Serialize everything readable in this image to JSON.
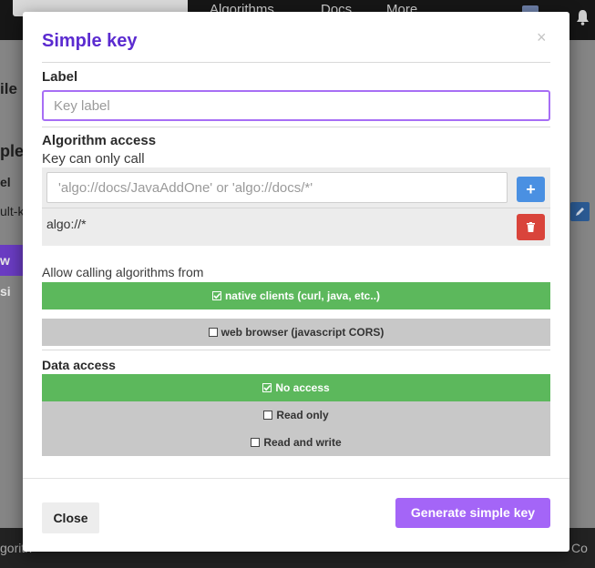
{
  "background": {
    "nav_fragments": [
      "Algorithms",
      "Docs",
      "More"
    ],
    "page_fragments": [
      "ile",
      "ple",
      "el",
      "ult-k"
    ],
    "purple_button_fragment": "w si",
    "footer_fragments": [
      "gorith",
      "Co"
    ]
  },
  "modal": {
    "title": "Simple key",
    "close_x": "×",
    "label": {
      "heading": "Label",
      "placeholder": "Key label",
      "value": ""
    },
    "algorithm_access": {
      "heading": "Algorithm access",
      "subheading": "Key can only call",
      "input_placeholder": "'algo://docs/JavaAddOne' or 'algo://docs/*'",
      "add_label": "+",
      "items": [
        "algo://*"
      ]
    },
    "calling_from": {
      "heading": "Allow calling algorithms from",
      "options": [
        {
          "label": "native clients (curl, java, etc..)",
          "checked": true
        },
        {
          "label": "web browser (javascript CORS)",
          "checked": false
        }
      ]
    },
    "data_access": {
      "heading": "Data access",
      "options": [
        {
          "label": "No access",
          "checked": true
        },
        {
          "label": "Read only",
          "checked": false
        },
        {
          "label": "Read and write",
          "checked": false
        }
      ]
    },
    "close_button": "Close",
    "generate_button": "Generate simple key"
  },
  "colors": {
    "accent": "#a465f7",
    "title": "#5b2bd0",
    "selected_green": "#5cb85c",
    "unselected_gray": "#c8c8c8",
    "add_blue": "#4a90e2",
    "delete_red": "#d9443b"
  },
  "icons": {
    "checked": "check-square-icon",
    "unchecked": "square-icon",
    "delete": "trash-icon",
    "add": "plus-icon"
  }
}
